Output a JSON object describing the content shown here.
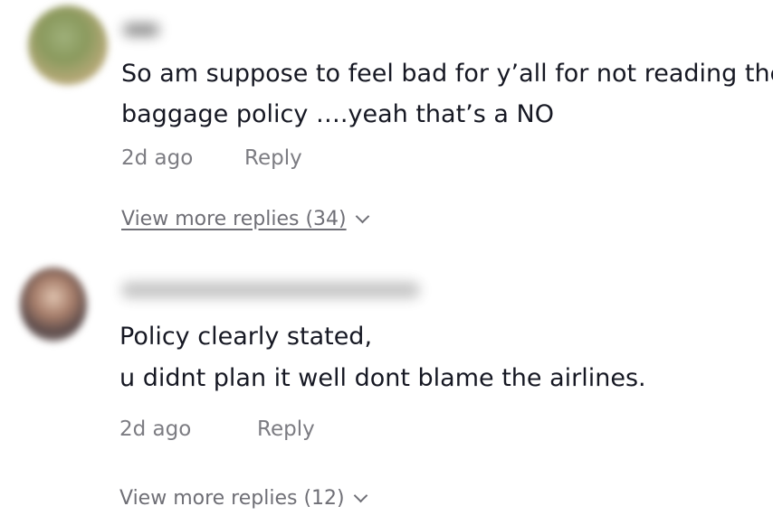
{
  "comments": [
    {
      "text_line1": "So am suppose to feel bad for y’all for not reading the",
      "text_line2": "baggage policy ….yeah that’s a NO",
      "time": "2d ago",
      "reply_label": "Reply",
      "view_more_label": "View more replies (34)"
    },
    {
      "text_line1": "Policy clearly stated,",
      "text_line2": "u didnt plan it well dont blame the airlines.",
      "time": "2d ago",
      "reply_label": "Reply",
      "view_more_label": "View more replies (12)"
    }
  ],
  "icons": {
    "expand": "chevron-down-icon"
  }
}
